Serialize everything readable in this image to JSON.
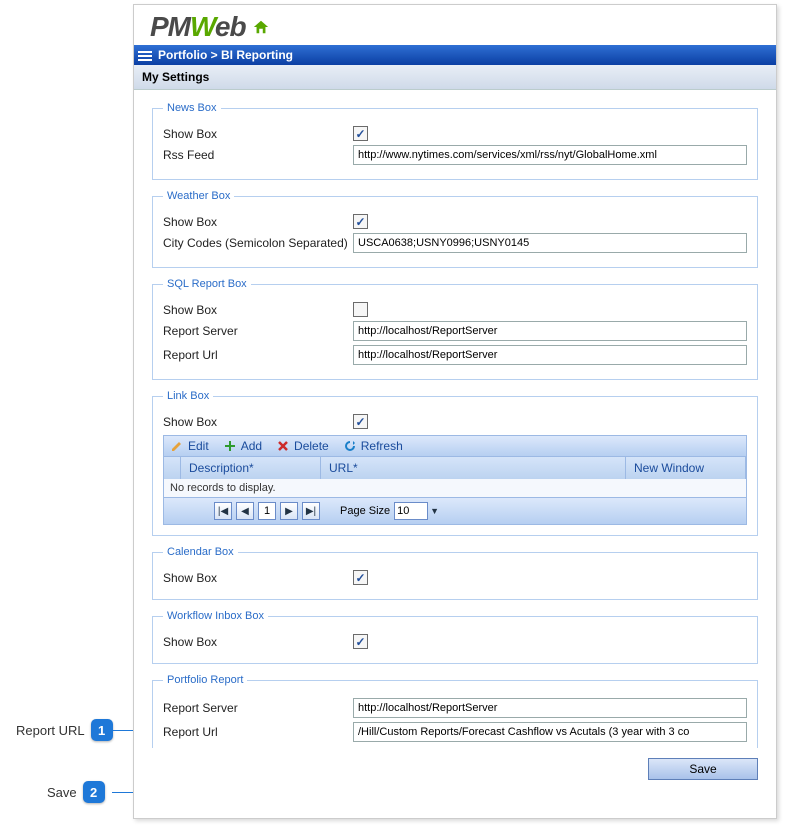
{
  "logo": {
    "pm": "PM",
    "w": "W",
    "eb": "eb"
  },
  "breadcrumb": "Portfolio > BI Reporting",
  "subheader": "My Settings",
  "boxes": {
    "news": {
      "legend": "News Box",
      "show_label": "Show Box",
      "show_checked": true,
      "rss_label": "Rss Feed",
      "rss_value": "http://www.nytimes.com/services/xml/rss/nyt/GlobalHome.xml"
    },
    "weather": {
      "legend": "Weather Box",
      "show_label": "Show Box",
      "show_checked": true,
      "codes_label": "City Codes (Semicolon Separated)",
      "codes_value": "USCA0638;USNY0996;USNY0145"
    },
    "sql": {
      "legend": "SQL Report Box",
      "show_label": "Show Box",
      "show_checked": false,
      "server_label": "Report Server",
      "server_value": "http://localhost/ReportServer",
      "url_label": "Report Url",
      "url_value": "http://localhost/ReportServer"
    },
    "link": {
      "legend": "Link Box",
      "show_label": "Show Box",
      "show_checked": true,
      "toolbar": {
        "edit": "Edit",
        "add": "Add",
        "delete": "Delete",
        "refresh": "Refresh"
      },
      "columns": {
        "desc": "Description*",
        "url": "URL*",
        "neww": "New Window"
      },
      "empty": "No records to display.",
      "pager": {
        "page": "1",
        "size_label": "Page Size",
        "size": "10"
      }
    },
    "calendar": {
      "legend": "Calendar Box",
      "show_label": "Show Box",
      "show_checked": true
    },
    "workflow": {
      "legend": "Workflow Inbox Box",
      "show_label": "Show Box",
      "show_checked": true
    },
    "portfolio": {
      "legend": "Portfolio Report",
      "server_label": "Report Server",
      "server_value": "http://localhost/ReportServer",
      "url_label": "Report Url",
      "url_value": "/Hill/Custom Reports/Forecast Cashflow vs Acutals (3 year with 3 co"
    }
  },
  "save_label": "Save",
  "callouts": {
    "c1": {
      "label": "Report URL",
      "num": "1"
    },
    "c2": {
      "label": "Save",
      "num": "2"
    }
  }
}
